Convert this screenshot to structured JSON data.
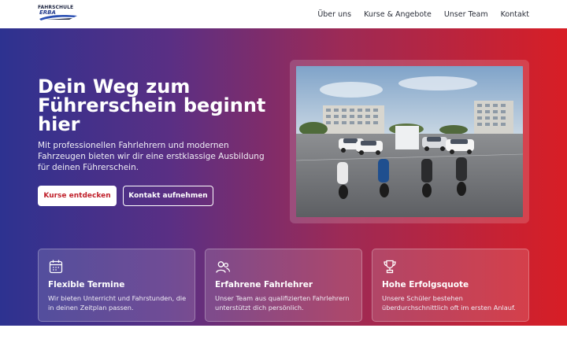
{
  "brand": {
    "logo_line1": "FAHRSCHULE",
    "logo_line2": "ERBA"
  },
  "nav": {
    "items": [
      {
        "label": "Über uns"
      },
      {
        "label": "Kurse & Angebote"
      },
      {
        "label": "Unser Team"
      },
      {
        "label": "Kontakt"
      }
    ]
  },
  "hero": {
    "title": "Dein Weg zum Führerschein beginnt hier",
    "subtitle": "Mit professionellen Fahrlehrern und modernen Fahrzeugen bieten wir dir eine erstklassige Ausbildung für deinen Führerschein.",
    "primary_button": "Kurse entdecken",
    "secondary_button": "Kontakt aufnehmen"
  },
  "features": [
    {
      "icon": "calendar-icon",
      "title": "Flexible Termine",
      "text": "Wir bieten Unterricht und Fahrstunden, die in deinen Zeitplan passen."
    },
    {
      "icon": "users-icon",
      "title": "Erfahrene Fahrlehrer",
      "text": "Unser Team aus qualifizierten Fahrlehrern unterstützt dich persönlich."
    },
    {
      "icon": "trophy-icon",
      "title": "Hohe Erfolgsquote",
      "text": "Unsere Schüler bestehen überdurchschnittlich oft im ersten Anlauf."
    }
  ],
  "colors": {
    "gradient_start": "#2d3290",
    "gradient_end": "#d81e25",
    "accent_red": "#c0202a"
  }
}
